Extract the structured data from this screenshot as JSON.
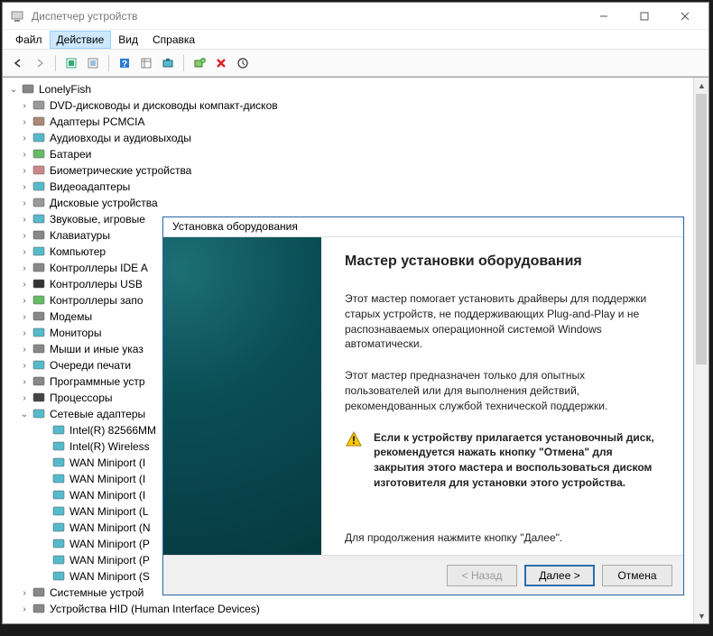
{
  "window": {
    "title": "Диспетчер устройств"
  },
  "menu": {
    "file": "Файл",
    "action": "Действие",
    "view": "Вид",
    "help": "Справка"
  },
  "toolbar_icons": [
    "back-icon",
    "forward-icon",
    "|",
    "show-hidden-icon",
    "properties-icon",
    "|",
    "help-icon",
    "details-icon",
    "scan-icon",
    "|",
    "add-legacy-icon",
    "remove-icon",
    "update-icon"
  ],
  "tree": {
    "root": "LonelyFish",
    "categories": [
      {
        "label": "DVD-дисководы и дисководы компакт-дисков",
        "collapsed": true,
        "icon": "optical"
      },
      {
        "label": "Адаптеры PCMCIA",
        "collapsed": true,
        "icon": "pcmcia"
      },
      {
        "label": "Аудиовходы и аудиовыходы",
        "collapsed": true,
        "icon": "audio"
      },
      {
        "label": "Батареи",
        "collapsed": true,
        "icon": "battery"
      },
      {
        "label": "Биометрические устройства",
        "collapsed": true,
        "icon": "biometric"
      },
      {
        "label": "Видеоадаптеры",
        "collapsed": true,
        "icon": "display"
      },
      {
        "label": "Дисковые устройства",
        "collapsed": true,
        "icon": "disk"
      },
      {
        "label": "Звуковые, игровые",
        "collapsed": true,
        "icon": "sound",
        "truncated": true
      },
      {
        "label": "Клавиатуры",
        "collapsed": true,
        "icon": "keyboard"
      },
      {
        "label": "Компьютер",
        "collapsed": true,
        "icon": "computer"
      },
      {
        "label": "Контроллеры IDE A",
        "collapsed": true,
        "icon": "ide",
        "truncated": true
      },
      {
        "label": "Контроллеры USB",
        "collapsed": true,
        "icon": "usb"
      },
      {
        "label": "Контроллеры запо",
        "collapsed": true,
        "icon": "storage",
        "truncated": true
      },
      {
        "label": "Модемы",
        "collapsed": true,
        "icon": "modem"
      },
      {
        "label": "Мониторы",
        "collapsed": true,
        "icon": "monitor"
      },
      {
        "label": "Мыши и иные указ",
        "collapsed": true,
        "icon": "mouse",
        "truncated": true
      },
      {
        "label": "Очереди печати",
        "collapsed": true,
        "icon": "printer"
      },
      {
        "label": "Программные устр",
        "collapsed": true,
        "icon": "software",
        "truncated": true
      },
      {
        "label": "Процессоры",
        "collapsed": true,
        "icon": "cpu"
      },
      {
        "label": "Сетевые адаптеры",
        "collapsed": false,
        "icon": "network",
        "children": [
          {
            "label": "Intel(R) 82566MM",
            "icon": "nic",
            "truncated": true
          },
          {
            "label": "Intel(R) Wireless",
            "icon": "nic",
            "truncated": true
          },
          {
            "label": "WAN Miniport (I",
            "icon": "nic",
            "truncated": true
          },
          {
            "label": "WAN Miniport (I",
            "icon": "nic",
            "truncated": true
          },
          {
            "label": "WAN Miniport (I",
            "icon": "nic",
            "truncated": true
          },
          {
            "label": "WAN Miniport (L",
            "icon": "nic",
            "truncated": true
          },
          {
            "label": "WAN Miniport (N",
            "icon": "nic",
            "truncated": true
          },
          {
            "label": "WAN Miniport (P",
            "icon": "nic",
            "truncated": true
          },
          {
            "label": "WAN Miniport (P",
            "icon": "nic",
            "truncated": true
          },
          {
            "label": "WAN Miniport (S",
            "icon": "nic",
            "truncated": true
          }
        ]
      },
      {
        "label": "Системные устрой",
        "collapsed": true,
        "icon": "system",
        "truncated": true
      },
      {
        "label": "Устройства HID (Human Interface Devices)",
        "collapsed": true,
        "icon": "hid"
      }
    ]
  },
  "wizard": {
    "title": "Установка оборудования",
    "heading": "Мастер установки оборудования",
    "p1": "Этот мастер помогает установить драйверы для поддержки старых устройств, не поддерживающих Plug-and-Play и не распознаваемых операционной системой Windows автоматически.",
    "p2": "Этот мастер предназначен только для опытных пользователей или для выполнения действий, рекомендованных службой технической поддержки.",
    "warn": "Если к устройству прилагается установочный диск, рекомендуется нажать кнопку \"Отмена\" для закрытия этого мастера и воспользоваться диском изготовителя для установки этого устройства.",
    "continue": "Для продолжения нажмите кнопку \"Далее\".",
    "back": "< Назад",
    "next": "Далее >",
    "cancel": "Отмена"
  }
}
